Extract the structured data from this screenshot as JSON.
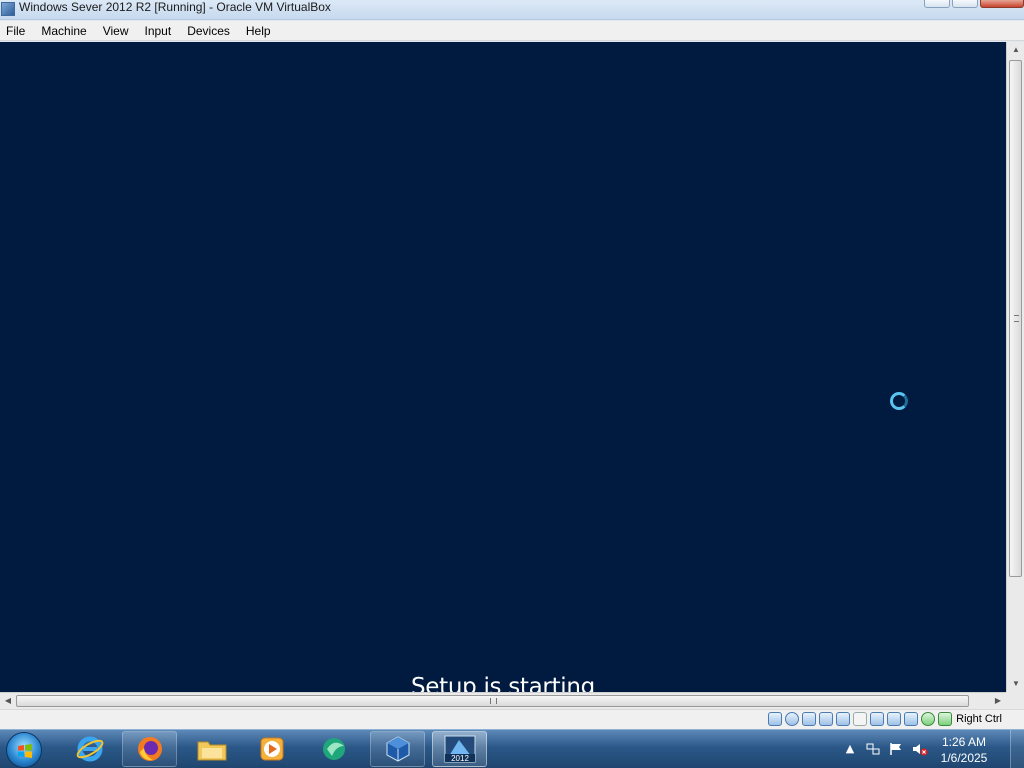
{
  "window": {
    "title": "Windows Sever 2012 R2 [Running] - Oracle VM VirtualBox",
    "controls": [
      "minimize",
      "maximize",
      "close"
    ]
  },
  "menu": {
    "items": [
      "File",
      "Machine",
      "View",
      "Input",
      "Devices",
      "Help"
    ]
  },
  "vm": {
    "background_color": "#001a40",
    "status_text": "Setup is starting",
    "spinner_icon": "loading-spinner-icon"
  },
  "statusbar": {
    "icons": [
      "hard-disk-icon",
      "optical-drive-icon",
      "audio-icon",
      "network-icon",
      "usb-icon",
      "shared-folders-icon",
      "display-icon",
      "video-capture-icon",
      "recording-icon",
      "cpu-icon",
      "mouse-integration-icon",
      "keyboard-icon"
    ],
    "host_key": "Right Ctrl"
  },
  "taskbar": {
    "start_icon": "windows-start-icon",
    "pinned": [
      {
        "name": "internet-explorer-icon",
        "state": "idle"
      },
      {
        "name": "firefox-icon",
        "state": "open"
      },
      {
        "name": "file-explorer-icon",
        "state": "idle"
      },
      {
        "name": "media-player-icon",
        "state": "idle"
      },
      {
        "name": "app-icon",
        "state": "idle"
      },
      {
        "name": "virtualbox-icon",
        "state": "open"
      },
      {
        "name": "server-2012-vm-icon",
        "state": "active",
        "label": "2012"
      }
    ],
    "tray_icons": [
      "show-hidden-icons-icon",
      "network-icon",
      "action-center-flag-icon",
      "volume-muted-icon"
    ],
    "clock": {
      "time": "1:26 AM",
      "date": "1/6/2025"
    }
  }
}
